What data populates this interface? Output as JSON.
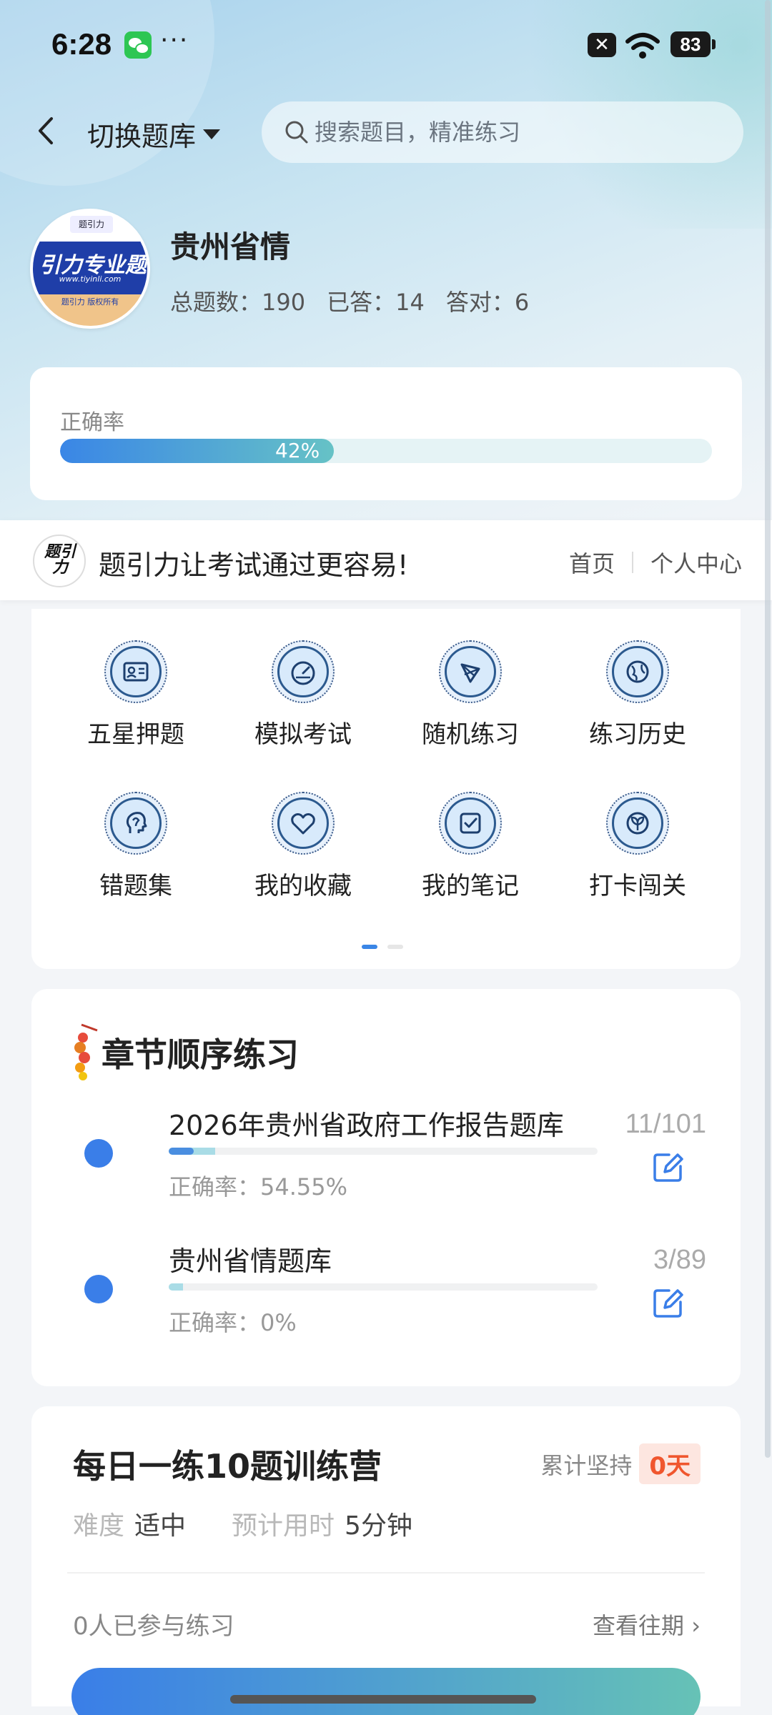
{
  "status_bar": {
    "time": "6:28",
    "more": "···",
    "x_badge": "✕",
    "battery": "83"
  },
  "header": {
    "switch_label": "切换题库",
    "search_placeholder": "搜索题目，精准练习"
  },
  "logo": {
    "mark": "题引力",
    "name": "引力专业题",
    "url": "www.tiyinli.com",
    "copyright": "题引力 版权所有"
  },
  "bank": {
    "title": "贵州省情",
    "total": "总题数：190",
    "answered": "已答：14",
    "correct": "答对：6"
  },
  "accuracy": {
    "label": "正确率",
    "text": "42%",
    "value": 0.42
  },
  "promo": {
    "logo_text": "题引力",
    "slogan": "题引力让考试通过更容易!",
    "home": "首页",
    "personal": "个人中心"
  },
  "features": [
    {
      "label": "五星押题",
      "icon": "id-card-icon"
    },
    {
      "label": "模拟考试",
      "icon": "gauge-icon"
    },
    {
      "label": "随机练习",
      "icon": "shuffle-icon"
    },
    {
      "label": "练习历史",
      "icon": "globe-icon"
    },
    {
      "label": "错题集",
      "icon": "head-icon"
    },
    {
      "label": "我的收藏",
      "icon": "heart-icon"
    },
    {
      "label": "我的笔记",
      "icon": "note-check-icon"
    },
    {
      "label": "打卡闯关",
      "icon": "sprout-icon"
    }
  ],
  "chapter": {
    "title": "章节顺序练习",
    "items": [
      {
        "name": "2026年贵州省政府工作报告题库",
        "accuracy": "正确率：54.55%",
        "count": "11/101",
        "progress": 0.109,
        "correct_ratio": 0.5455
      },
      {
        "name": "贵州省情题库",
        "accuracy": "正确率：0%",
        "count": "3/89",
        "progress": 0.034,
        "correct_ratio": 0
      }
    ]
  },
  "daily": {
    "title": "每日一练10题训练营",
    "streak_label": "累计坚持",
    "streak_value": "0天",
    "difficulty_label": "难度",
    "difficulty_value": "适中",
    "time_label": "预计用时",
    "time_value": "5分钟",
    "participants": "0人已参与练习",
    "past_link": "查看往期 ›"
  },
  "colors": {
    "accent": "#3a7ee8",
    "teal": "#66c2c6",
    "streak": "#f0562e"
  }
}
